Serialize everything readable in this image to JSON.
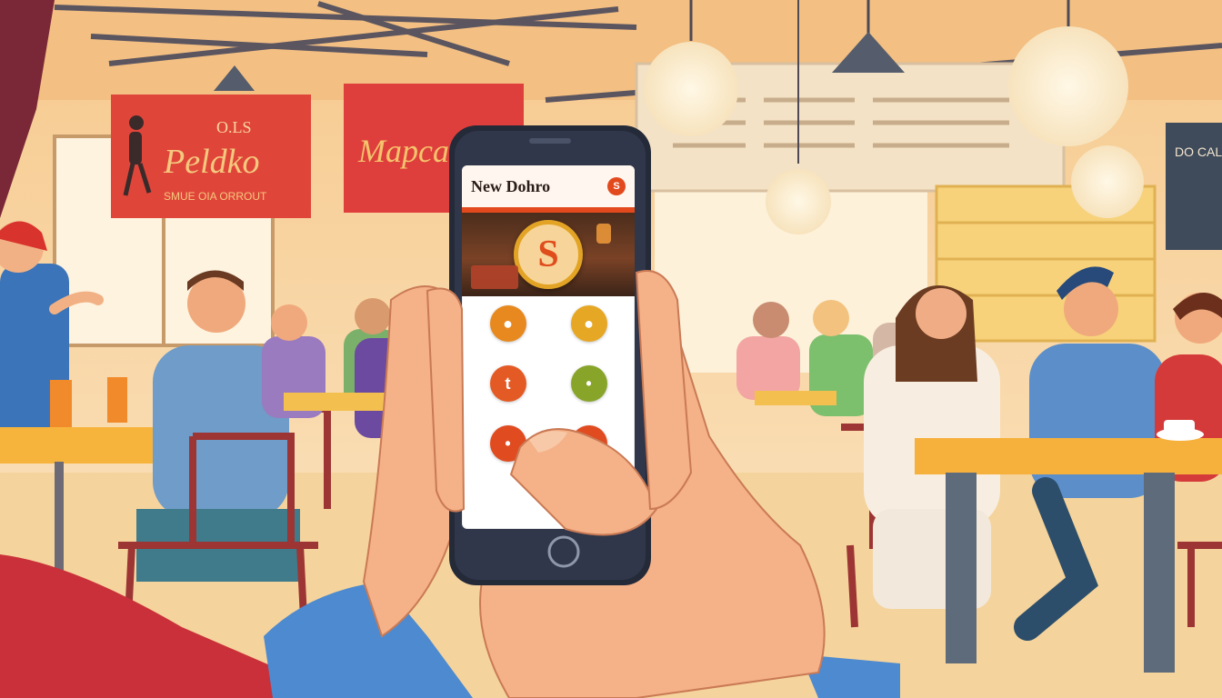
{
  "scene": {
    "description_free": true
  },
  "signs": {
    "left_banner_small": "O.LS",
    "left_banner_main": "Peldko",
    "left_banner_sub": "SMUE OIA ORROUT",
    "mid_banner": "Mapcalk",
    "right_board_title": "DO CALI"
  },
  "phone": {
    "app_title": "New Dohro",
    "logo_letter": "S",
    "hero_letter": "S",
    "tiles": [
      {
        "label": "",
        "icon": "food-icon",
        "color": "#e7891f",
        "glyph": "●"
      },
      {
        "label": "",
        "icon": "coffee-icon",
        "color": "#e6a724",
        "glyph": "●"
      },
      {
        "label": "",
        "icon": "menu-icon",
        "color": "#e45a24",
        "glyph": "t"
      },
      {
        "label": "",
        "icon": "leaf-icon",
        "color": "#88a52a",
        "glyph": "•"
      },
      {
        "label": "",
        "icon": "order-icon",
        "color": "#e04b20",
        "glyph": "•"
      },
      {
        "label": "",
        "icon": "more-icon",
        "color": "#e04b20",
        "glyph": "S"
      }
    ]
  },
  "colors": {
    "accent": "#e24a1e",
    "wall": "#f9d9a8",
    "floor": "#f5d39c"
  }
}
